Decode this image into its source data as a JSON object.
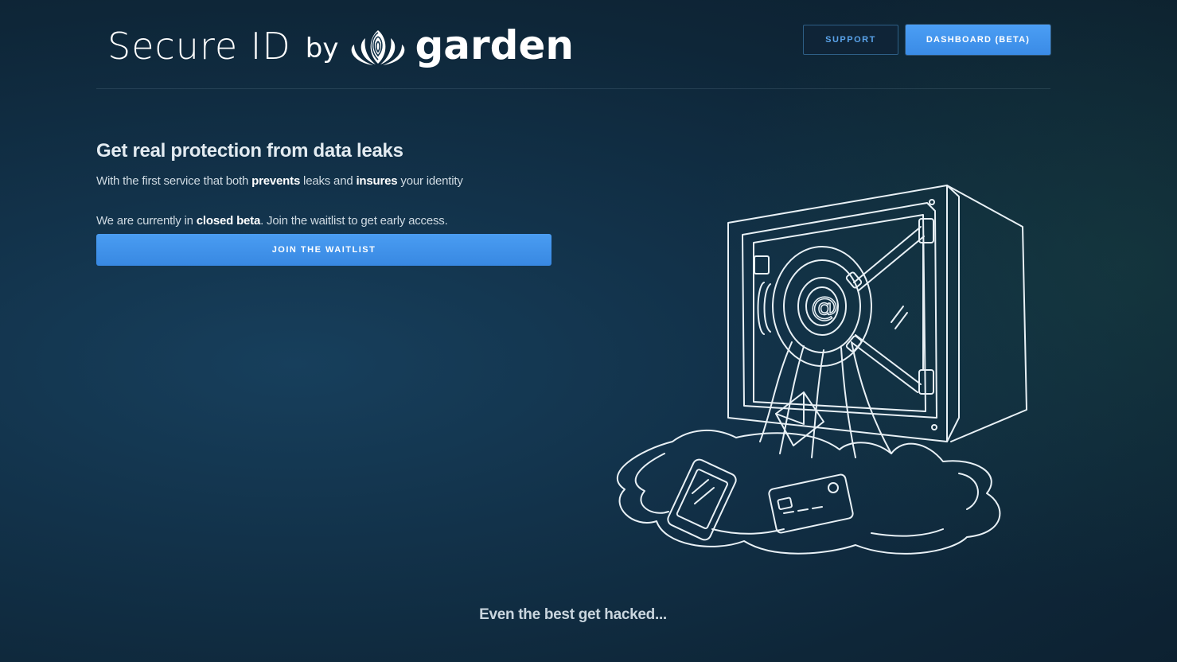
{
  "header": {
    "logo_brand": "Secure ID",
    "logo_by": "by",
    "logo_company": "garden",
    "support_label": "SUPPORT",
    "dashboard_label": "DASHBOARD (BETA)"
  },
  "hero": {
    "title": "Get real protection from data leaks",
    "sub_part1": "With the first service that both ",
    "sub_bold1": "prevents",
    "sub_part2": " leaks and ",
    "sub_bold2": "insures",
    "sub_part3": " your identity",
    "beta_part1": "We are currently in ",
    "beta_bold": "closed beta",
    "beta_part2": ". Join the waitlist to get early access.",
    "waitlist_label": "JOIN THE WAITLIST"
  },
  "illustration": {
    "safe_symbol": "@"
  },
  "footer": {
    "tagline": "Even the best get hacked..."
  },
  "colors": {
    "accent": "#3a8be6",
    "background": "#12324a"
  },
  "icons": {
    "logo": "lotus-fingerprint-icon",
    "illustration": "leaking-safe-illustration"
  }
}
